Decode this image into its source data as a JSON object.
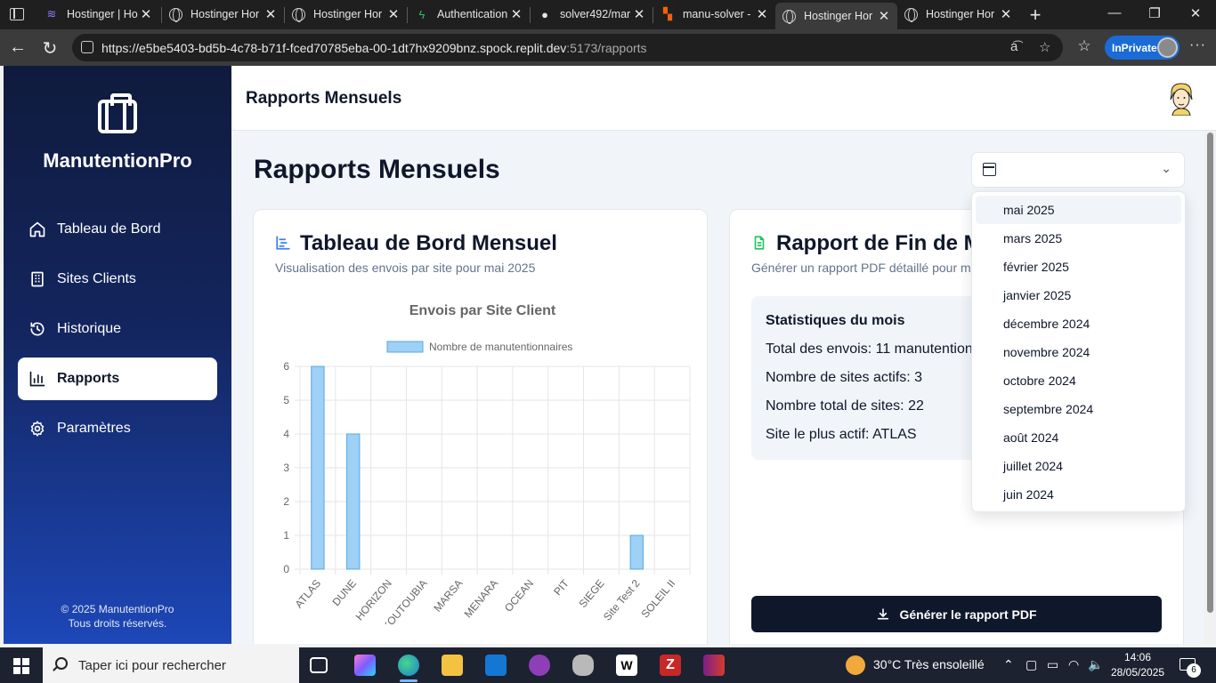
{
  "browser": {
    "tabs": [
      {
        "title": "Hostinger | Ho",
        "icon": "hostinger-icon",
        "active": false
      },
      {
        "title": "Hostinger Hor",
        "icon": "globe-icon",
        "active": false
      },
      {
        "title": "Hostinger Hor",
        "icon": "globe-icon",
        "active": false
      },
      {
        "title": "Authentication",
        "icon": "bolt-icon",
        "active": false
      },
      {
        "title": "solver492/mar",
        "icon": "github-icon",
        "active": false
      },
      {
        "title": "manu-solver -",
        "icon": "replit-icon",
        "active": false
      },
      {
        "title": "Hostinger Hor",
        "icon": "globe-icon",
        "active": true
      },
      {
        "title": "Hostinger Hor",
        "icon": "globe-icon",
        "active": false
      }
    ],
    "url_host": "https://e5be5403-bd5b-4c78-b71f-fced70785eba-00-1dt7hx9209bnz.spock.replit.dev",
    "url_path": ":5173/rapports",
    "inprivate_label": "InPrivate"
  },
  "sidebar": {
    "brand": "ManutentionPro",
    "items": [
      {
        "label": "Tableau de Bord",
        "icon": "home-icon",
        "active": false
      },
      {
        "label": "Sites Clients",
        "icon": "building-icon",
        "active": false
      },
      {
        "label": "Historique",
        "icon": "history-icon",
        "active": false
      },
      {
        "label": "Rapports",
        "icon": "bar-chart-icon",
        "active": true
      },
      {
        "label": "Paramètres",
        "icon": "gear-icon",
        "active": false
      }
    ],
    "footer_line1": "© 2025 ManutentionPro",
    "footer_line2": "Tous droits réservés."
  },
  "header": {
    "title": "Rapports Mensuels"
  },
  "page": {
    "title": "Rapports Mensuels",
    "month_select": {
      "value": "",
      "options": [
        "mai 2025",
        "mars 2025",
        "février 2025",
        "janvier 2025",
        "décembre 2024",
        "novembre 2024",
        "octobre 2024",
        "septembre 2024",
        "août 2024",
        "juillet 2024",
        "juin 2024"
      ],
      "highlighted": "mai 2025"
    },
    "dashboard_card": {
      "title": "Tableau de Bord Mensuel",
      "subtitle": "Visualisation des envois par site pour mai 2025"
    },
    "report_card": {
      "title": "Rapport de Fin de Mo",
      "subtitle": "Générer un rapport PDF détaillé pour m",
      "stats_title": "Statistiques du mois",
      "stats": [
        "Total des envois: 11 manutention",
        "Nombre de sites actifs: 3",
        "Nombre total de sites: 22",
        "Site le plus actif: ATLAS"
      ],
      "button_label": "Générer le rapport PDF"
    }
  },
  "chart_data": {
    "type": "bar",
    "title": "Envois par Site Client",
    "categories": [
      "ATLAS",
      "DUNE",
      "HORIZON",
      "KOUTOUBIA",
      "MARSA",
      "MENARA",
      "OCEAN",
      "PIT",
      "SIEGE",
      "Site Test 2",
      "SOLEIL II"
    ],
    "series": [
      {
        "name": "Nombre de manutentionnaires",
        "values": [
          6,
          4,
          0,
          0,
          0,
          0,
          0,
          0,
          0,
          1,
          0
        ]
      }
    ],
    "ylim": [
      0,
      6
    ],
    "yticks": [
      "0",
      "1",
      "2",
      "3",
      "4",
      "5",
      "6"
    ],
    "grid": true,
    "legend_position": "top",
    "bar_fill": "#9fd0f5",
    "bar_stroke": "#53a8e5"
  },
  "taskbar": {
    "search_placeholder": "Taper ici pour rechercher",
    "weather": "30°C  Très ensoleillé",
    "time": "14:06",
    "date": "28/05/2025",
    "notifications": "6"
  }
}
